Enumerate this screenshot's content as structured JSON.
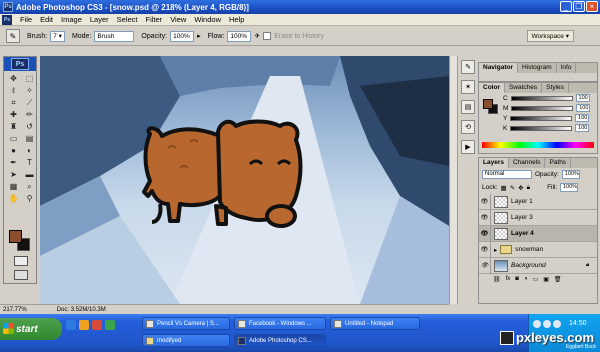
{
  "window": {
    "title": "Adobe Photoshop CS3 - [snow.psd @ 218% (Layer 4, RGB/8)]"
  },
  "menu": [
    "File",
    "Edit",
    "Image",
    "Layer",
    "Select",
    "Filter",
    "View",
    "Window",
    "Help"
  ],
  "options": {
    "brush_label": "Brush:",
    "brush_size": "7",
    "mode_label": "Mode:",
    "mode_value": "Brush",
    "opacity_label": "Opacity:",
    "opacity_value": "100%",
    "flow_label": "Flow:",
    "flow_value": "100%",
    "erase_to_history": "Erase to History",
    "workspace": "Workspace ▾"
  },
  "toolbox": {
    "ps_logo": "Ps",
    "tools": [
      "move",
      "marquee",
      "lasso",
      "magic-wand",
      "crop",
      "slice",
      "healing",
      "brush",
      "stamp",
      "history-brush",
      "eraser",
      "gradient",
      "blur",
      "dodge",
      "pen",
      "type",
      "path-select",
      "shape",
      "notes",
      "eyedropper",
      "hand",
      "zoom"
    ],
    "foreground_color": "#8a4f2a",
    "background_color": "#111111"
  },
  "status": {
    "zoom": "217.77%",
    "doc": "Doc: 3.52M/10.3M"
  },
  "panels": {
    "navigator_tabs": [
      "Navigator",
      "Histogram",
      "Info"
    ],
    "color_tabs": [
      "Color",
      "Swatches",
      "Styles"
    ],
    "color": {
      "channels": [
        {
          "label": "C",
          "value": "100"
        },
        {
          "label": "M",
          "value": "100"
        },
        {
          "label": "Y",
          "value": "100"
        },
        {
          "label": "K",
          "value": "100"
        }
      ]
    },
    "layers_tabs": [
      "Layers",
      "Channels",
      "Paths"
    ],
    "layers": {
      "blend_mode": "Normal",
      "opacity_label": "Opacity:",
      "opacity_value": "100%",
      "lock_label": "Lock:",
      "fill_label": "Fill:",
      "fill_value": "100%",
      "items": [
        {
          "name": "Layer 1",
          "type": "layer",
          "selected": false
        },
        {
          "name": "Layer 3",
          "type": "layer",
          "selected": false
        },
        {
          "name": "Layer 4",
          "type": "layer",
          "selected": true
        },
        {
          "name": "snowman",
          "type": "group",
          "selected": false
        },
        {
          "name": "Background",
          "type": "background",
          "selected": false
        }
      ]
    }
  },
  "taskbar": {
    "start": "start",
    "buttons": [
      {
        "label": "Pencil Vs Camera | S..."
      },
      {
        "label": "Facebook - Windows ..."
      },
      {
        "label": "Untitled - Notepad"
      },
      {
        "label": "modifyed"
      },
      {
        "label": "Adobe Photoshop CS..."
      }
    ],
    "clock": "14:50",
    "watermark": "pxleyes.com",
    "signature": "Eggbert Bock"
  },
  "colors": {
    "xp_blue": "#245edb",
    "start_green": "#2f8a2f",
    "pig_brown": "#b8682e",
    "tray_blue": "#0c8ad8"
  }
}
